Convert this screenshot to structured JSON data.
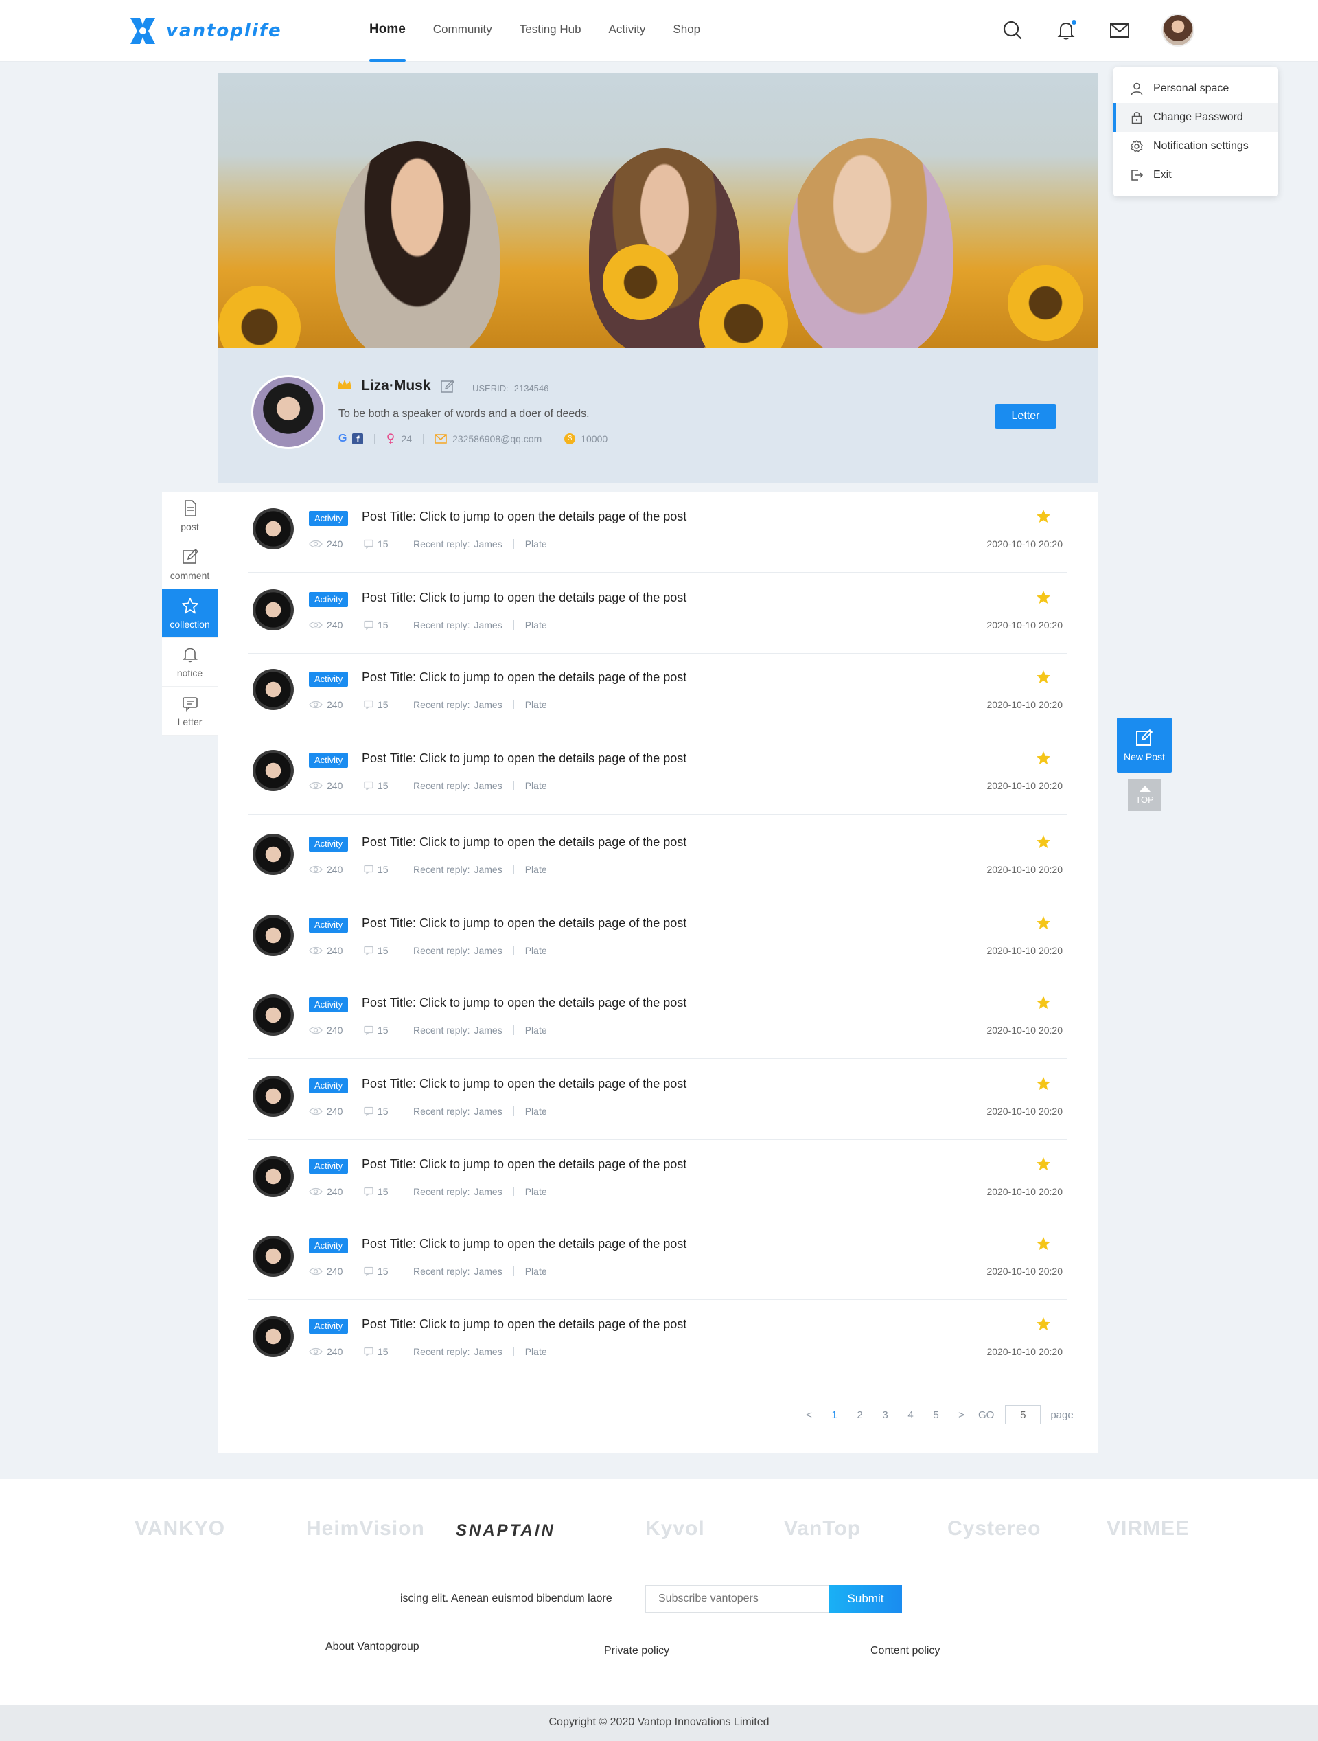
{
  "brand": {
    "name": "vantoplife",
    "accent": "#1a8cf0"
  },
  "nav": {
    "items": [
      {
        "label": "Home",
        "active": true
      },
      {
        "label": "Community"
      },
      {
        "label": "Testing Hub"
      },
      {
        "label": "Activity"
      },
      {
        "label": "Shop"
      }
    ]
  },
  "header_icons": [
    "search-icon",
    "bell-icon",
    "mail-icon",
    "avatar"
  ],
  "dropdown": {
    "items": [
      {
        "label": "Personal space",
        "icon": "user-icon"
      },
      {
        "label": "Change Password",
        "icon": "lock-icon",
        "active": true
      },
      {
        "label": "Notification settings",
        "icon": "gear-icon"
      },
      {
        "label": "Exit",
        "icon": "exit-icon"
      }
    ]
  },
  "profile": {
    "name": "Liza·Musk",
    "userid_label": "USERID:",
    "userid": "2134546",
    "bio": "To be both a speaker of words and a doer of deeds.",
    "age": "24",
    "email": "232586908@qq.com",
    "coins": "10000",
    "letter_button": "Letter"
  },
  "side_tabs": [
    {
      "label": "post",
      "icon": "document-icon"
    },
    {
      "label": "comment",
      "icon": "edit-icon"
    },
    {
      "label": "collection",
      "icon": "star-icon",
      "active": true
    },
    {
      "label": "notice",
      "icon": "bell-icon"
    },
    {
      "label": "Letter",
      "icon": "chat-icon"
    }
  ],
  "posts": [
    {
      "tag": "Activity",
      "title": "Post Title: Click to jump to open the details page of the post",
      "views": "240",
      "comments": "15",
      "reply_label": "Recent reply:",
      "reply_user": "James",
      "plate": "Plate",
      "date": "2020-10-10  20:20"
    },
    {
      "tag": "Activity",
      "title": "Post Title: Click to jump to open the details page of the post",
      "views": "240",
      "comments": "15",
      "reply_label": "Recent reply:",
      "reply_user": "James",
      "plate": "Plate",
      "date": "2020-10-10  20:20"
    },
    {
      "tag": "Activity",
      "title": "Post Title: Click to jump to open the details page of the post",
      "views": "240",
      "comments": "15",
      "reply_label": "Recent reply:",
      "reply_user": "James",
      "plate": "Plate",
      "date": "2020-10-10  20:20"
    },
    {
      "tag": "Activity",
      "title": "Post Title: Click to jump to open the details page of the post",
      "views": "240",
      "comments": "15",
      "reply_label": "Recent reply:",
      "reply_user": "James",
      "plate": "Plate",
      "date": "2020-10-10  20:20"
    },
    {
      "tag": "Activity",
      "title": "Post Title: Click to jump to open the details page of the post",
      "views": "240",
      "comments": "15",
      "reply_label": "Recent reply:",
      "reply_user": "James",
      "plate": "Plate",
      "date": "2020-10-10  20:20"
    },
    {
      "tag": "Activity",
      "title": "Post Title: Click to jump to open the details page of the post",
      "views": "240",
      "comments": "15",
      "reply_label": "Recent reply:",
      "reply_user": "James",
      "plate": "Plate",
      "date": "2020-10-10  20:20"
    },
    {
      "tag": "Activity",
      "title": "Post Title: Click to jump to open the details page of the post",
      "views": "240",
      "comments": "15",
      "reply_label": "Recent reply:",
      "reply_user": "James",
      "plate": "Plate",
      "date": "2020-10-10  20:20"
    },
    {
      "tag": "Activity",
      "title": "Post Title: Click to jump to open the details page of the post",
      "views": "240",
      "comments": "15",
      "reply_label": "Recent reply:",
      "reply_user": "James",
      "plate": "Plate",
      "date": "2020-10-10  20:20"
    },
    {
      "tag": "Activity",
      "title": "Post Title: Click to jump to open the details page of the post",
      "views": "240",
      "comments": "15",
      "reply_label": "Recent reply:",
      "reply_user": "James",
      "plate": "Plate",
      "date": "2020-10-10  20:20"
    },
    {
      "tag": "Activity",
      "title": "Post Title: Click to jump to open the details page of the post",
      "views": "240",
      "comments": "15",
      "reply_label": "Recent reply:",
      "reply_user": "James",
      "plate": "Plate",
      "date": "2020-10-10  20:20"
    },
    {
      "tag": "Activity",
      "title": "Post Title: Click to jump to open the details page of the post",
      "views": "240",
      "comments": "15",
      "reply_label": "Recent reply:",
      "reply_user": "James",
      "plate": "Plate",
      "date": "2020-10-10  20:20"
    }
  ],
  "pagination": {
    "prev": "<",
    "next": ">",
    "pages": [
      "1",
      "2",
      "3",
      "4",
      "5"
    ],
    "current": "1",
    "go_label": "GO",
    "input_value": "5",
    "unit": "page"
  },
  "floating": {
    "new_post": "New Post",
    "top": "TOP"
  },
  "footer": {
    "brands": [
      "VANKYO",
      "HeimVision",
      "SNAPTAIN",
      "Kyvol",
      "VanTop",
      "Cystereo",
      "VIRMEE"
    ],
    "subscribe_text": "iscing elit. Aenean euismod bibendum laore",
    "subscribe_placeholder": "Subscribe vantopers",
    "submit_label": "Submit",
    "links": [
      "About  Vantopgroup",
      "Private policy",
      "Content policy"
    ],
    "copyright": "Copyright © 2020 Vantop Innovations Limited"
  }
}
